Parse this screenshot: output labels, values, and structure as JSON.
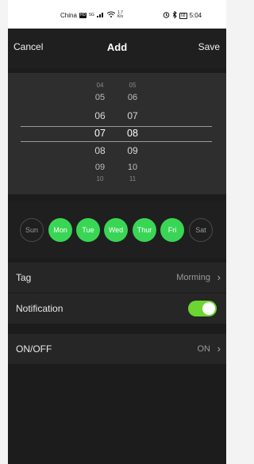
{
  "status_bar": {
    "carrier": "China",
    "hd": "HD",
    "net": "5G",
    "speed_value": "1.7",
    "speed_unit": "K/s",
    "battery": "68",
    "time": "5:04"
  },
  "header": {
    "cancel": "Cancel",
    "title": "Add",
    "save": "Save"
  },
  "picker": {
    "hours": [
      "04",
      "05",
      "06",
      "07",
      "08",
      "09",
      "10"
    ],
    "minutes": [
      "05",
      "06",
      "07",
      "08",
      "09",
      "10",
      "11"
    ],
    "selected_hour": "07",
    "selected_minute": "08"
  },
  "days": [
    {
      "label": "Sun",
      "selected": false
    },
    {
      "label": "Mon",
      "selected": true
    },
    {
      "label": "Tue",
      "selected": true
    },
    {
      "label": "Wed",
      "selected": true
    },
    {
      "label": "Thur",
      "selected": true
    },
    {
      "label": "Fri",
      "selected": true
    },
    {
      "label": "Sat",
      "selected": false
    }
  ],
  "tag": {
    "label": "Tag",
    "value": "Morming"
  },
  "notification": {
    "label": "Notification",
    "enabled": true
  },
  "onoff": {
    "label": "ON/OFF",
    "value": "ON"
  },
  "colors": {
    "accent_green": "#39d655",
    "toggle_green": "#6cd531"
  }
}
